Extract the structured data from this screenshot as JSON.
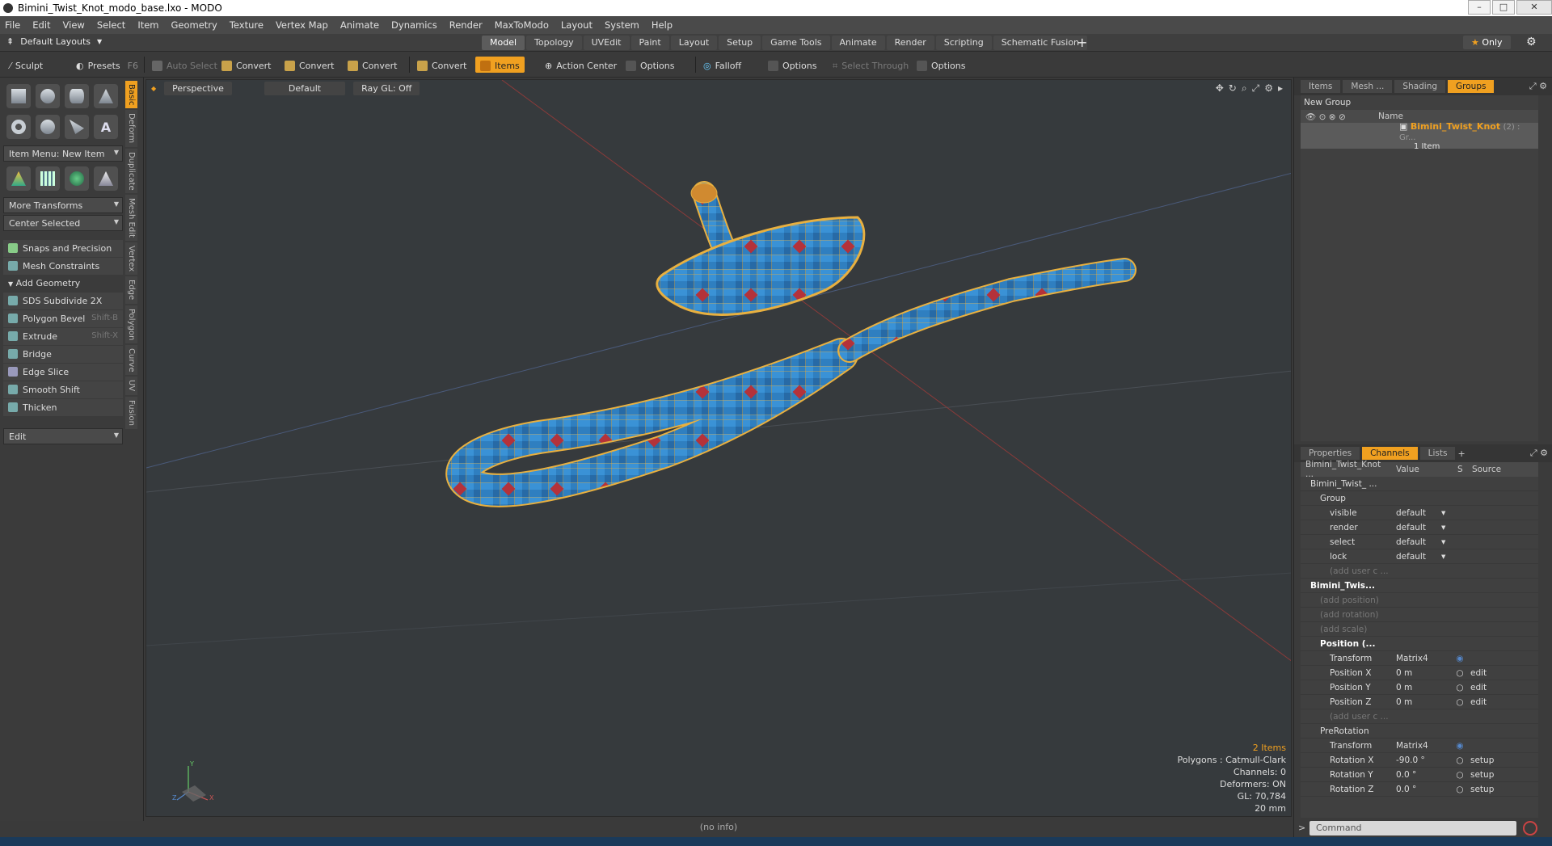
{
  "window": {
    "title": "Bimini_Twist_Knot_modo_base.lxo - MODO"
  },
  "menu": [
    "File",
    "Edit",
    "View",
    "Select",
    "Item",
    "Geometry",
    "Texture",
    "Vertex Map",
    "Animate",
    "Dynamics",
    "Render",
    "MaxToModo",
    "Layout",
    "System",
    "Help"
  ],
  "layoutbar": {
    "default_layouts": "Default Layouts",
    "tabs": [
      "Model",
      "Topology",
      "UVEdit",
      "Paint",
      "Layout",
      "Setup",
      "Game Tools",
      "Animate",
      "Render",
      "Scripting",
      "Schematic Fusion"
    ],
    "active_tab": "Model",
    "only": "Only"
  },
  "toolbar": {
    "sculpt": "Sculpt",
    "presets": "Presets",
    "presets_key": "F6",
    "auto_select": "Auto Select",
    "convert1": "Convert",
    "convert2": "Convert",
    "convert3": "Convert",
    "convert4": "Convert",
    "items": "Items",
    "action_center": "Action Center",
    "options1": "Options",
    "falloff": "Falloff",
    "options2": "Options",
    "select_through": "Select Through",
    "options3": "Options"
  },
  "left": {
    "item_menu": "Item Menu: New Item",
    "more_transforms": "More Transforms",
    "center_selected": "Center Selected",
    "snaps": "Snaps and Precision",
    "mesh_constraints": "Mesh Constraints",
    "add_geometry": "Add Geometry",
    "tools": [
      {
        "label": "SDS Subdivide 2X",
        "key": ""
      },
      {
        "label": "Polygon Bevel",
        "key": "Shift-B"
      },
      {
        "label": "Extrude",
        "key": "Shift-X"
      },
      {
        "label": "Bridge",
        "key": ""
      },
      {
        "label": "Edge Slice",
        "key": ""
      },
      {
        "label": "Smooth Shift",
        "key": ""
      },
      {
        "label": "Thicken",
        "key": ""
      }
    ],
    "edit": "Edit",
    "vtabs": [
      "Basic",
      "Deform",
      "Duplicate",
      "Mesh Edit",
      "Vertex",
      "Edge",
      "Polygon",
      "Curve",
      "UV",
      "Fusion"
    ]
  },
  "viewport": {
    "perspective": "Perspective",
    "default": "Default",
    "raygl": "Ray GL: Off",
    "stats": {
      "items": "2 Items",
      "polygons": "Polygons : Catmull-Clark",
      "channels": "Channels: 0",
      "deformers": "Deformers: ON",
      "gl": "GL: 70,784",
      "scale": "20 mm"
    }
  },
  "status": {
    "info": "(no info)"
  },
  "right": {
    "tabs_top": [
      "Items",
      "Mesh ...",
      "Shading",
      "Groups"
    ],
    "active_top": "Groups",
    "new_group": "New Group",
    "name_header": "Name",
    "group_name": "Bimini_Twist_Knot",
    "group_count": "(2) : Gr...",
    "group_sub": "1 Item",
    "tabs_bottom": [
      "Properties",
      "Channels",
      "Lists"
    ],
    "active_bottom": "Channels",
    "ch_headers": {
      "name": "Bimini_Twist_Knot ...",
      "value": "Value",
      "s": "S",
      "source": "Source"
    },
    "channels": [
      {
        "name": "Bimini_Twist_ ...",
        "value": "",
        "src": ""
      },
      {
        "name": "Group",
        "value": "",
        "src": ""
      },
      {
        "name": "visible",
        "value": "default",
        "src": ""
      },
      {
        "name": "render",
        "value": "default",
        "src": ""
      },
      {
        "name": "select",
        "value": "default",
        "src": ""
      },
      {
        "name": "lock",
        "value": "default",
        "src": ""
      },
      {
        "name": "(add user c ...",
        "value": "",
        "src": ""
      },
      {
        "name": "Bimini_Twis...",
        "value": "",
        "src": ""
      },
      {
        "name": "(add position)",
        "value": "",
        "src": ""
      },
      {
        "name": "(add rotation)",
        "value": "",
        "src": ""
      },
      {
        "name": "(add scale)",
        "value": "",
        "src": ""
      },
      {
        "name": "Position (...",
        "value": "",
        "src": ""
      },
      {
        "name": "Transform",
        "value": "Matrix4",
        "src": ""
      },
      {
        "name": "Position X",
        "value": "0 m",
        "src": "edit"
      },
      {
        "name": "Position Y",
        "value": "0 m",
        "src": "edit"
      },
      {
        "name": "Position Z",
        "value": "0 m",
        "src": "edit"
      },
      {
        "name": "(add user c ...",
        "value": "",
        "src": ""
      },
      {
        "name": "PreRotation",
        "value": "",
        "src": ""
      },
      {
        "name": "Transform",
        "value": "Matrix4",
        "src": ""
      },
      {
        "name": "Rotation X",
        "value": "-90.0 °",
        "src": "setup"
      },
      {
        "name": "Rotation Y",
        "value": "0.0 °",
        "src": "setup"
      },
      {
        "name": "Rotation Z",
        "value": "0.0 °",
        "src": "setup"
      }
    ],
    "command": "Command"
  },
  "colors": {
    "accent": "#f0a020",
    "rope": "#2f7fc0",
    "wire": "#e8b040"
  }
}
